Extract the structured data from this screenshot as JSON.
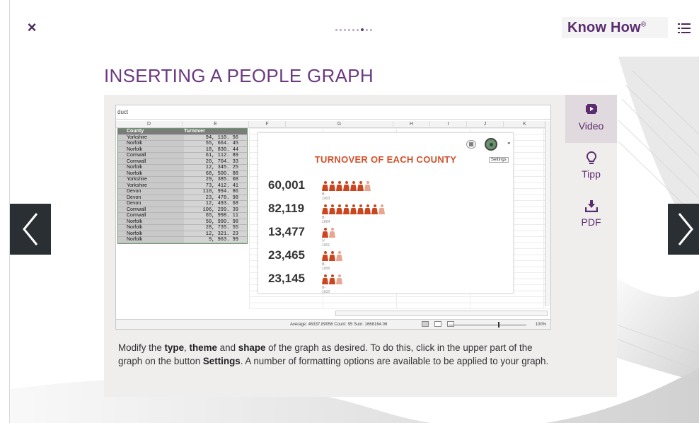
{
  "header": {
    "close_label": "×",
    "logo_text": "Know How",
    "logo_mark": "®",
    "pager": {
      "total": 9,
      "active_index": 6
    }
  },
  "page": {
    "title": "INSERTING A PEOPLE GRAPH"
  },
  "excel": {
    "formula_bar_text": "duct",
    "columns": [
      "D",
      "E",
      "F",
      "G",
      "H",
      "I",
      "J",
      "K"
    ],
    "table_headers": [
      "County",
      "Turnover"
    ],
    "rows": [
      [
        "Yorkshire",
        "94, 110. 56"
      ],
      [
        "Norfolk",
        "55, 664. 45"
      ],
      [
        "Norfolk",
        "18, 830. 44"
      ],
      [
        "Cornwall",
        "61, 112. 89"
      ],
      [
        "Cornwall",
        "20, 704. 33"
      ],
      [
        "Norfolk",
        "12, 345. 25"
      ],
      [
        "Norfolk",
        "68, 500. 88"
      ],
      [
        "Yorkshire",
        "29, 385. 08"
      ],
      [
        "Yorkshire",
        "73, 412. 41"
      ],
      [
        "Devon",
        "110, 994. 86"
      ],
      [
        "Devon",
        "23, 478. 98"
      ],
      [
        "Devon",
        "12, 493. 68"
      ],
      [
        "Cornwall",
        "106, 299. 39"
      ],
      [
        "Cornwall",
        "65, 998. 11"
      ],
      [
        "Norfolk",
        "50, 990. 98"
      ],
      [
        "Norfolk",
        "28, 735. 55"
      ],
      [
        "Norfolk",
        "12, 321. 23"
      ],
      [
        "Norfolk",
        "9, 963. 99"
      ]
    ],
    "people_graph": {
      "title": "TURNOVER OF EACH COUNTY",
      "tooltip": "Settings",
      "items": [
        {
          "value": "60,001",
          "sub": "B-1003",
          "full": 6,
          "partial": 1
        },
        {
          "value": "82,119",
          "sub": "B-1004",
          "full": 8,
          "partial": 1
        },
        {
          "value": "13,477",
          "sub": "V-1001",
          "full": 1,
          "partial": 1
        },
        {
          "value": "23,465",
          "sub": "B-1006",
          "full": 2,
          "partial": 1
        },
        {
          "value": "23,145",
          "sub": "B-1010",
          "full": 2,
          "partial": 1
        }
      ]
    },
    "status_text": "Average: 46337.89056   Count: 95   Sum: 1668164.06",
    "zoom_text": "100%"
  },
  "instructions": {
    "t1": "Modify the ",
    "b1": "type",
    "t2": ", ",
    "b2": "theme",
    "t3": " and ",
    "b3": "shape",
    "t4": " of the graph as desired. To do this, click in the upper part of the graph on the button ",
    "b4": "Settings",
    "t5": ". A number of formatting options are available to be applied to your graph."
  },
  "sidebar": {
    "tabs": [
      {
        "label": "Video",
        "icon": "video-icon"
      },
      {
        "label": "Tipp",
        "icon": "lightbulb-icon"
      },
      {
        "label": "PDF",
        "icon": "download-icon"
      }
    ]
  },
  "colors": {
    "brand_purple": "#5b2c6f",
    "accent_orange": "#d2502b",
    "nav_dark": "#2a2f33"
  }
}
